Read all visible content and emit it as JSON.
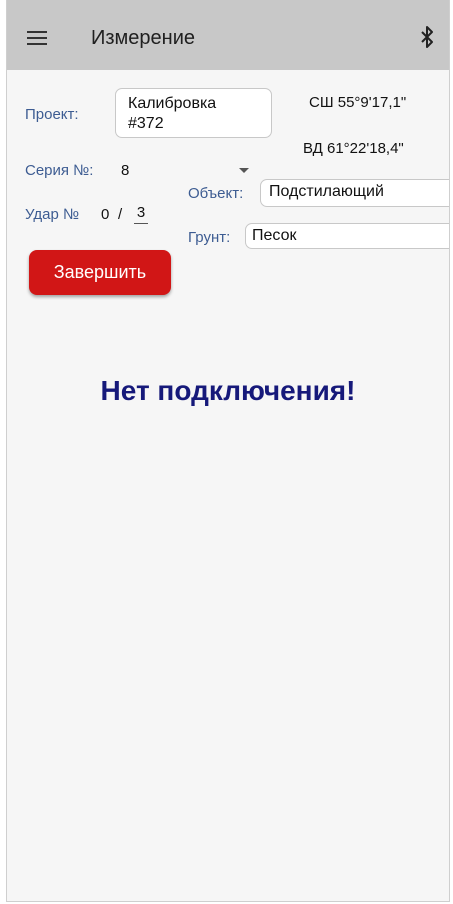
{
  "app_bar": {
    "title": "Измерение",
    "menu_icon": "hamburger-menu-icon",
    "bluetooth_icon": "bluetooth-icon"
  },
  "form": {
    "project": {
      "label": "Проект:",
      "value_line1": "Калибровка",
      "value_line2": "#372"
    },
    "series": {
      "label": "Серия №:",
      "value": "8"
    },
    "hit": {
      "label": "Удар №",
      "current": "0",
      "separator": "/",
      "total": "3"
    },
    "object": {
      "label": "Объект:",
      "value": "Подстилающий"
    },
    "soil": {
      "label": "Грунт:",
      "value": "Песок"
    }
  },
  "coordinates": {
    "latitude": "СШ 55°9'17,1\"",
    "longitude": "ВД 61°22'18,4\""
  },
  "finish_button": {
    "label": "Завершить",
    "color": "#d11616"
  },
  "status_message": {
    "text": "Нет подключения!",
    "color": "#16197a"
  }
}
